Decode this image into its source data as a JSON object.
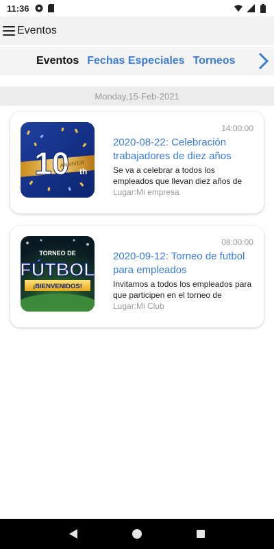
{
  "status_bar": {
    "time": "11:36",
    "icons": [
      "notification-icon",
      "sd-card-icon",
      "wifi-icon",
      "signal-icon",
      "battery-icon"
    ]
  },
  "app_bar": {
    "menu_icon": "hamburger-menu-icon",
    "title": "Eventos"
  },
  "tabs": [
    {
      "label": "Eventos",
      "active": true
    },
    {
      "label": "Fechas Especiales",
      "active": false
    },
    {
      "label": "Torneos",
      "active": false
    }
  ],
  "tabs_scroll_icon": "chevron-right-icon",
  "date_header": "Monday,15-Feb-2021",
  "events": [
    {
      "time": "14:00:00",
      "title": "2020-08-22: Celebración trabajadores de diez años",
      "description": "Se va a celebrar a todos los empleados que llevan diez años de",
      "place": "Lugar:Mi empresa",
      "image": {
        "number": "10",
        "suffix": "th",
        "banner": "ANNIVER"
      }
    },
    {
      "time": "08:00:00",
      "title": "2020-09-12: Torneo de futbol para empleados",
      "description": "Invitamos a todos los empleados para que participen en el torneo de",
      "place": "Lugar:Mi Club",
      "image": {
        "top": "TORNEO DE",
        "main": "FÚTBOL",
        "banner": "¡BIENVENIDOS!"
      }
    }
  ],
  "nav_bar": {
    "back": "back-triangle-icon",
    "home": "home-circle-icon",
    "recents": "recents-square-icon"
  },
  "colors": {
    "accent": "#3a7bd5",
    "muted": "#9a9a9a"
  }
}
